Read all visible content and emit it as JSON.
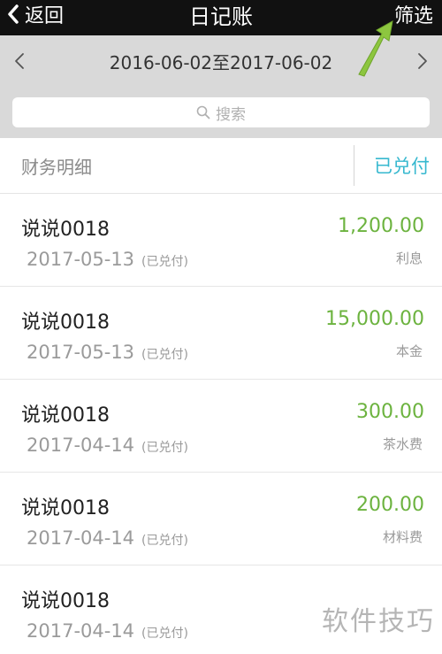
{
  "header": {
    "back_label": "返回",
    "title": "日记账",
    "filter_label": "筛选"
  },
  "date_range": {
    "text": "2016-06-02至2017-06-02"
  },
  "search": {
    "placeholder": "搜索"
  },
  "tabs": {
    "left_label": "财务明细",
    "right_label": "已兑付"
  },
  "entries": [
    {
      "name": "说说0018",
      "date": "2017-05-13",
      "status": "(已兑付)",
      "amount": "1,200.00",
      "category": "利息"
    },
    {
      "name": "说说0018",
      "date": "2017-05-13",
      "status": "(已兑付)",
      "amount": "15,000.00",
      "category": "本金"
    },
    {
      "name": "说说0018",
      "date": "2017-04-14",
      "status": "(已兑付)",
      "amount": "300.00",
      "category": "茶水费"
    },
    {
      "name": "说说0018",
      "date": "2017-04-14",
      "status": "(已兑付)",
      "amount": "200.00",
      "category": "材料费"
    },
    {
      "name": "说说0018",
      "date": "2017-04-14",
      "status": "(已兑付)",
      "amount": "",
      "category": ""
    }
  ],
  "watermark": "软件技巧",
  "colors": {
    "header_bg": "#111111",
    "accent": "#36b8cf",
    "amount_green": "#6cb33f",
    "arrow_green": "#8dc63f"
  },
  "icons": {
    "back": "chevron-left-icon",
    "prev": "chevron-left-icon",
    "next": "chevron-right-icon",
    "search": "search-icon",
    "annotation": "arrow-annotation-icon"
  }
}
